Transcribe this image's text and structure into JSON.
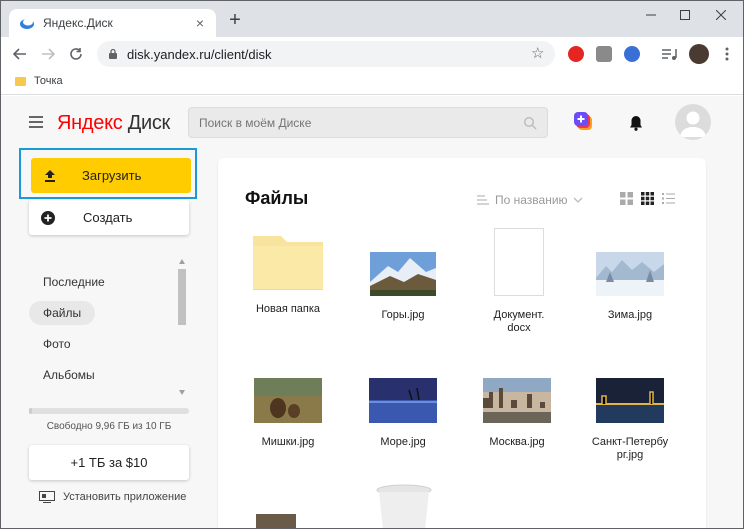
{
  "browser": {
    "tab_title": "Яндекс.Диск",
    "url": "disk.yandex.ru/client/disk",
    "bookmark": "Точка"
  },
  "header": {
    "logo_yandex": "Яндекс",
    "logo_disk": "Диск",
    "search_placeholder": "Поиск в моём Диске"
  },
  "sidebar": {
    "upload_label": "Загрузить",
    "create_label": "Создать",
    "items": [
      {
        "label": "Последние",
        "active": false
      },
      {
        "label": "Файлы",
        "active": true
      },
      {
        "label": "Фото",
        "active": false
      },
      {
        "label": "Альбомы",
        "active": false
      }
    ],
    "quota_used_fraction": 0.004,
    "quota_text": "Свободно 9,96 ГБ из 10 ГБ",
    "buy_label": "+1 ТБ за $10",
    "install_label": "Установить приложение"
  },
  "main": {
    "title": "Файлы",
    "sort_label": "По названию",
    "files": [
      {
        "name": "Новая папка",
        "type": "folder"
      },
      {
        "name": "Горы.jpg",
        "type": "image",
        "theme": "mountains"
      },
      {
        "name": "Документ.\ndocx",
        "type": "doc"
      },
      {
        "name": "Зима.jpg",
        "type": "image",
        "theme": "winter"
      },
      {
        "name": "Мишки.jpg",
        "type": "image",
        "theme": "bears"
      },
      {
        "name": "Море.jpg",
        "type": "image",
        "theme": "sea"
      },
      {
        "name": "Москва.jpg",
        "type": "image",
        "theme": "moscow"
      },
      {
        "name": "Санкт-Петербург.jpg",
        "type": "image",
        "theme": "spb"
      }
    ]
  },
  "colors": {
    "accent_yellow": "#ffcc00",
    "highlight_blue": "#1a9bd6",
    "logo_red": "#ff0000"
  }
}
